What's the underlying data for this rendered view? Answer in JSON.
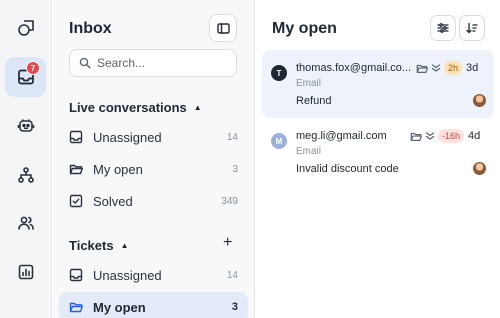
{
  "rail": {
    "items": [
      {
        "name": "home",
        "icon": "shapes-icon"
      },
      {
        "name": "inbox",
        "icon": "inbox-tray-icon",
        "badge": "7",
        "active": true
      },
      {
        "name": "bot",
        "icon": "bot-icon"
      },
      {
        "name": "workflows",
        "icon": "hierarchy-icon"
      },
      {
        "name": "contacts",
        "icon": "users-icon"
      },
      {
        "name": "reports",
        "icon": "bar-chart-icon"
      }
    ]
  },
  "inbox": {
    "title": "Inbox",
    "search_placeholder": "Search...",
    "live_section": "Live conversations",
    "live_items": [
      {
        "label": "Unassigned",
        "count": "14"
      },
      {
        "label": "My open",
        "count": "3"
      },
      {
        "label": "Solved",
        "count": "349"
      }
    ],
    "tickets_section": "Tickets",
    "ticket_items": [
      {
        "label": "Unassigned",
        "count": "14"
      },
      {
        "label": "My open",
        "count": "3"
      }
    ]
  },
  "list": {
    "title": "My open",
    "conversations": [
      {
        "initial": "T",
        "email": "thomas.fox@gmail.co...",
        "channel": "Email",
        "subject": "Refund",
        "sla": "2h",
        "age": "3d"
      },
      {
        "initial": "M",
        "email": "meg.li@gmail.com",
        "channel": "Email",
        "subject": "Invalid discount code",
        "sla": "-16h",
        "age": "4d"
      }
    ]
  },
  "colors": {
    "accent": "#2563eb",
    "badge": "#e5484d",
    "sla_warning_bg": "#fde3b5",
    "sla_warning_fg": "#a15c07",
    "sla_overdue_bg": "#fde0e0",
    "sla_overdue_fg": "#d14343"
  }
}
